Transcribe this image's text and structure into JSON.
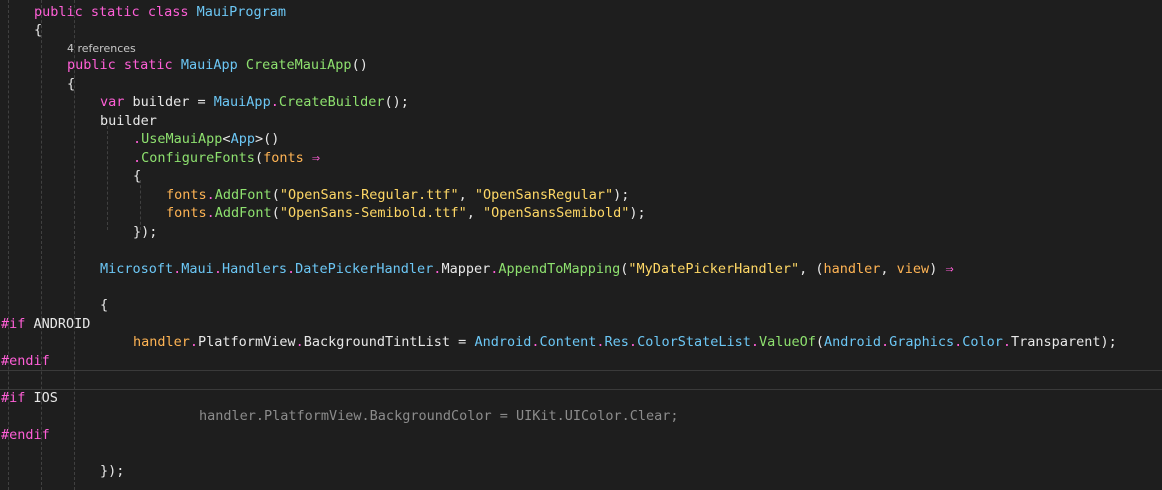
{
  "editor": {
    "theme": {
      "background": "#1e1e1e",
      "keyword": "#ff5fd7",
      "type": "#6cc7f5",
      "method": "#8ee16f",
      "string": "#ffd866",
      "parameter": "#ffb454",
      "inactive": "#8c8c8c"
    },
    "code": {
      "l1": {
        "public": "public",
        "static": "static",
        "class": "class",
        "name": "MauiProgram"
      },
      "l2": {
        "brace": "{"
      },
      "l3": {
        "refs": "4 references"
      },
      "l4": {
        "public": "public",
        "static": "static",
        "type": "MauiApp",
        "method": "CreateMauiApp",
        "parens": "()"
      },
      "l5": {
        "brace": "{"
      },
      "l6": {
        "var": "var",
        "text": " builder = ",
        "type": "MauiApp",
        "dot": ".",
        "method": "CreateBuilder",
        "end": "();"
      },
      "l7": {
        "text": "builder"
      },
      "l8": {
        "dot": ".",
        "method": "UseMauiApp",
        "lt": "<",
        "type": "App",
        "end": ">()"
      },
      "l9": {
        "dot": ".",
        "method": "ConfigureFonts",
        "open": "(",
        "param": "fonts",
        "arrow": "⇒"
      },
      "l10": {
        "brace": "{"
      },
      "l11": {
        "param": "fonts",
        "dot": ".",
        "method": "AddFont",
        "open": "(",
        "s1": "\"OpenSans-Regular.ttf\"",
        "comma": ", ",
        "s2": "\"OpenSansRegular\"",
        "end": ");"
      },
      "l12": {
        "param": "fonts",
        "dot": ".",
        "method": "AddFont",
        "open": "(",
        "s1": "\"OpenSans-Semibold.ttf\"",
        "comma": ", ",
        "s2": "\"OpenSansSemibold\"",
        "end": ");"
      },
      "l13": {
        "text": "});"
      },
      "l14": {
        "ns1": "Microsoft",
        "ns2": "Maui",
        "ns3": "Handlers",
        "type": "DatePickerHandler",
        "prop": "Mapper",
        "method": "AppendToMapping",
        "open": "(",
        "str": "\"MyDatePickerHandler\"",
        "sep": ", (",
        "p1": "handler",
        "comma": ", ",
        "p2": "view",
        "close": ") ",
        "arrow": "⇒",
        "dot": "."
      },
      "l15": {
        "brace": "{"
      },
      "l16": {
        "directive": "#if",
        "symbol": " ANDROID"
      },
      "l17": {
        "param": "handler",
        "prop1": "PlatformView",
        "prop2": "BackgroundTintList",
        "eq": " = ",
        "ns1": "Android",
        "ns2": "Content",
        "ns3": "Res",
        "type": "ColorStateList",
        "method": "ValueOf",
        "open": "(",
        "ns4": "Android",
        "ns5": "Graphics",
        "type2": "Color",
        "prop3": "Transparent",
        "end": ");",
        "dot": "."
      },
      "l18": {
        "directive": "#endif"
      },
      "l19": {
        "directive": "#if",
        "symbol": " IOS"
      },
      "l20": {
        "text": "handler.PlatformView.BackgroundColor = UIKit.UIColor.Clear;"
      },
      "l21": {
        "directive": "#endif"
      },
      "l22": {
        "text": "});"
      }
    }
  }
}
